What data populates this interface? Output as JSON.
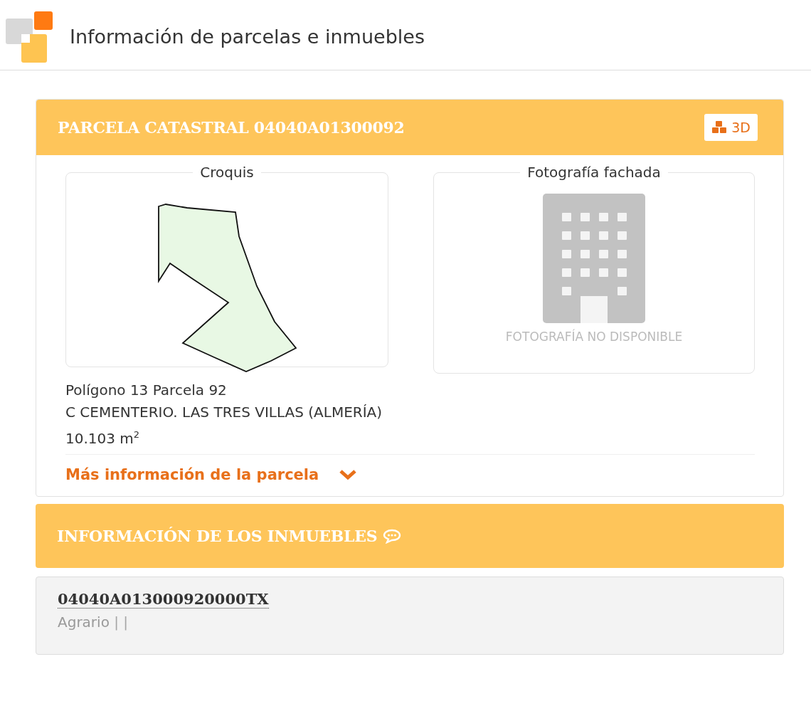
{
  "page": {
    "title": "Información de parcelas e inmuebles"
  },
  "parcel": {
    "title": "PARCELA CATASTRAL 04040A01300092",
    "button_3d": "3D",
    "sketch": {
      "legend": "Croquis"
    },
    "photo": {
      "legend": "Fotografía fachada",
      "unavailable": "FOTOGRAFÍA NO DISPONIBLE"
    },
    "details": [
      "Polígono 13 Parcela 92",
      "C CEMENTERIO. LAS TRES VILLAS (ALMERÍA)",
      "10.103 m$^{2}$"
    ],
    "more_link": "Más información de la parcela"
  },
  "properties": {
    "title": "INFORMACIÓN DE LOS INMUEBLES",
    "items": [
      {
        "reference": "04040A013000920000TX",
        "use": "Agrario",
        "separators": "| |"
      }
    ]
  }
}
